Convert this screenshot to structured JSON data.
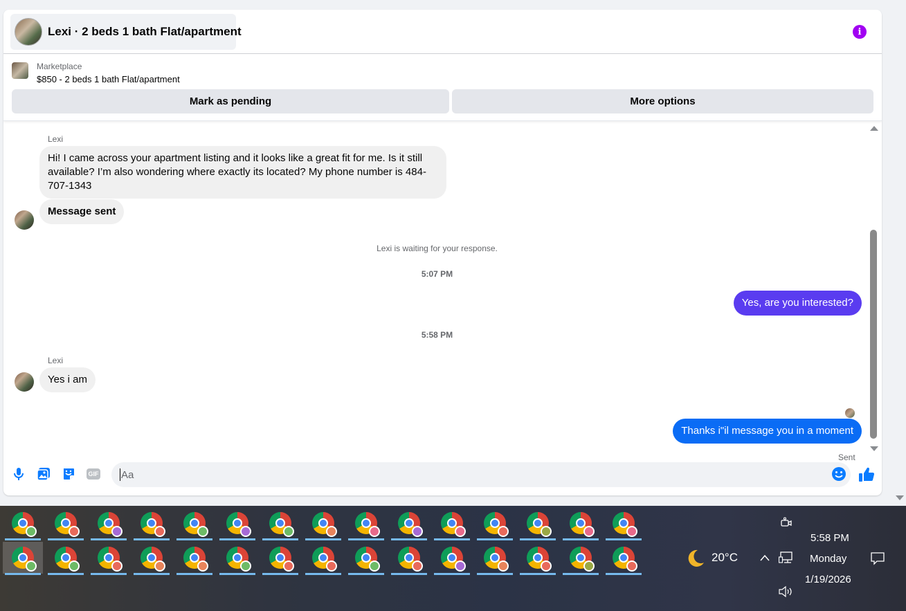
{
  "header": {
    "title": "Lexi · 2 beds 1 bath Flat/apartment",
    "info_icon": "info-icon",
    "accent": "#a100f2"
  },
  "listing": {
    "label": "Marketplace",
    "price_title": "$850 - 2 beds 1 bath Flat/apartment",
    "mark_pending_label": "Mark as pending",
    "more_options_label": "More options"
  },
  "messages": {
    "sender_name_1": "Lexi",
    "incoming_1": "Hi! I came across your apartment listing and it looks like a great fit for me. Is it still available? I’m also wondering where exactly its located? My phone number is 484-707-1343",
    "incoming_1b": "Message sent",
    "waiting_note": "Lexi is waiting for your response.",
    "time_1": "5:07 PM",
    "outgoing_1": "Yes, are you interested?",
    "outgoing_1_color": "#5a3cf0",
    "time_2": "5:58 PM",
    "sender_name_2": "Lexi",
    "incoming_2": "Yes i am",
    "outgoing_2": "Thanks i\"il message you in a moment",
    "outgoing_2_color": "#0a6cf5",
    "sent_status": "Sent"
  },
  "composer": {
    "placeholder": "Aa",
    "icons": [
      "microphone-icon",
      "photo-icon",
      "sticker-icon",
      "gif-icon",
      "emoji-icon",
      "thumbs-up-icon"
    ],
    "gif_label": "GIF",
    "accent": "#0a7cff"
  },
  "taskbar": {
    "row_1_profile_colors": [
      "#6dbb66",
      "#e86a5b",
      "#a66ad6",
      "#e86a5b",
      "#6dbb66",
      "#a66ad6",
      "#6dbb66",
      "#e8845b",
      "#e86a8b",
      "#a66ad6",
      "#e86a8b",
      "#e86a5b",
      "#9aa845",
      "#e86a8b",
      "#e86a8b"
    ],
    "row_2_profile_colors": [
      "#6dbb66",
      "#6dbb66",
      "#e86a5b",
      "#e8845b",
      "#e8845b",
      "#6dbb66",
      "#e86a5b",
      "#e86a5b",
      "#6dbb66",
      "#e86a5b",
      "#a66ad6",
      "#e8845b",
      "#e86a5b",
      "#9aa845",
      "#e86a5b"
    ],
    "active_index_row_2": 0
  },
  "tray": {
    "weather_icon": "moon-icon",
    "temperature": "20°C",
    "time": "5:58 PM",
    "day": "Monday",
    "date": "1/19/2026",
    "icons": [
      "meet-now-icon",
      "chevron-up-icon",
      "network-icon",
      "volume-icon",
      "notifications-icon"
    ]
  }
}
